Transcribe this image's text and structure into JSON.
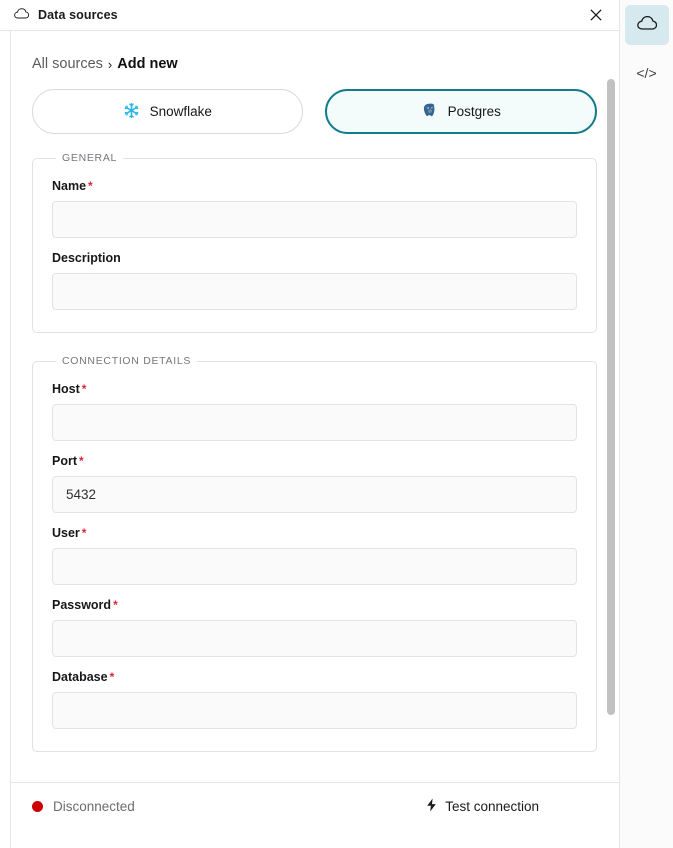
{
  "window": {
    "title": "Data sources",
    "title_icon": "cloud-icon",
    "close_icon": "close-icon"
  },
  "breadcrumb": {
    "root": "All sources",
    "separator": "›",
    "current": "Add new"
  },
  "source_tabs": [
    {
      "label": "Snowflake",
      "icon": "snowflake-icon",
      "selected": false
    },
    {
      "label": "Postgres",
      "icon": "postgres-elephant-icon",
      "selected": true
    }
  ],
  "general_section": {
    "legend": "GENERAL",
    "fields": [
      {
        "label": "Name",
        "required": true,
        "value": "",
        "placeholder": ""
      },
      {
        "label": "Description",
        "required": false,
        "value": "",
        "placeholder": ""
      }
    ]
  },
  "connection_section": {
    "legend": "CONNECTION DETAILS",
    "fields": [
      {
        "label": "Host",
        "required": true,
        "value": "",
        "placeholder": ""
      },
      {
        "label": "Port",
        "required": true,
        "value": "5432",
        "placeholder": ""
      },
      {
        "label": "User",
        "required": true,
        "value": "",
        "placeholder": ""
      },
      {
        "label": "Password",
        "required": true,
        "value": "",
        "placeholder": ""
      },
      {
        "label": "Database",
        "required": true,
        "value": "",
        "placeholder": ""
      }
    ]
  },
  "statusbar": {
    "connection_status": "Disconnected",
    "status_color": "#cc0000",
    "test_button": "Test connection",
    "test_button_icon": "lightning-bolt-icon"
  },
  "right_rail": {
    "items": [
      {
        "icon": "cloud-icon",
        "active": true
      },
      {
        "icon": "code-brackets-icon",
        "active": false,
        "glyph": "</>"
      }
    ]
  },
  "required_marker": "*",
  "colors": {
    "accent": "#137c8b",
    "selected_tab_bg": "#f4fbfb",
    "required": "#e0213a",
    "snowflake": "#29b5e8",
    "postgres": "#336791",
    "rail_active_bg": "#d6e9ef"
  }
}
